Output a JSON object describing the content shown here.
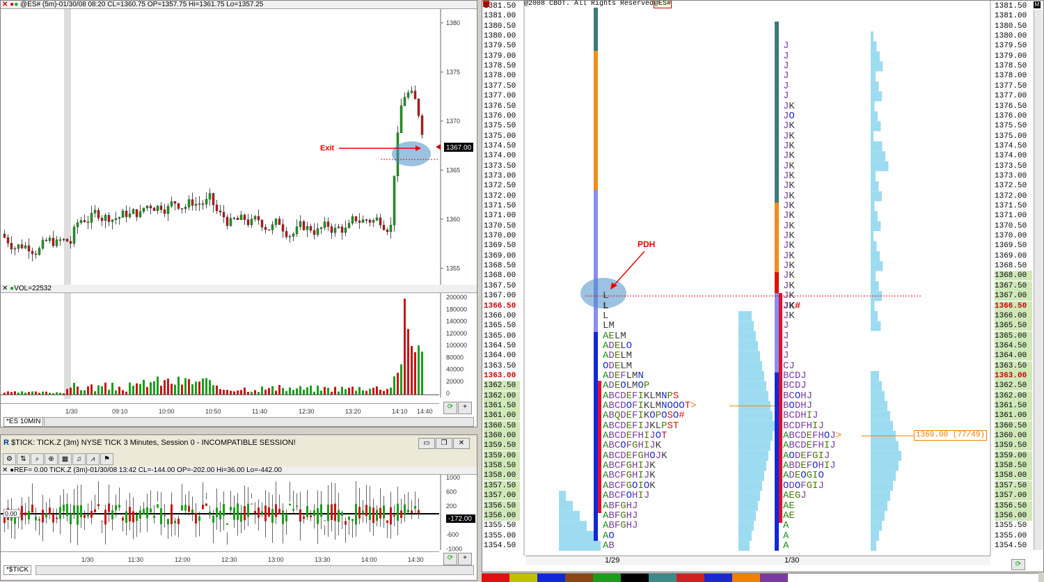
{
  "es_chart": {
    "header": "@ES# (5m)-01/30/08 08:20 CL=1360.75 OP=1357.75 Hi=1361.75 Lo=1357.25",
    "y_ticks": [
      "1380",
      "1375",
      "1370",
      "1365",
      "1360",
      "1355"
    ],
    "last_price": "1367.00",
    "exit_label": "Exit",
    "vol_header": "VOL=22532",
    "vol_ticks": [
      "200000",
      "180000",
      "140000",
      "120000",
      "100000",
      "80000",
      "40000",
      "20000",
      "0"
    ],
    "x_ticks": [
      "1/30",
      "09:10",
      "10:00",
      "10:50",
      "11:40",
      "12:30",
      "13:20",
      "14:10",
      "14:40"
    ],
    "tab": "*ES 10MIN"
  },
  "tick_chart": {
    "title": "$TICK: TICK.Z (3m) NYSE TICK 3 Minutes, Session 0 - INCOMPATIBLE SESSION!",
    "header": "REF= 0.00  TICK.Z (3m)-01/30/08 13:42 CL=-144.00 OP=-202.00 Hi=36.00 Lo=-442.00",
    "y_ticks": [
      "1000",
      "600",
      "200",
      "-200",
      "-600",
      "-1000"
    ],
    "zero_label": "0.00",
    "last_value": "-172.00",
    "x_ticks": [
      "1/30",
      "11:30",
      "12:00",
      "12:30",
      "13:00",
      "13:30",
      "14:00",
      "14:30"
    ],
    "tab": "*$TICK"
  },
  "market_profile": {
    "copyright": "@2008 CBOT. All Rights Reserved",
    "symbol": "@ES#",
    "pdh_label": "PDH",
    "value_label": "1360.00 (77/49)",
    "day1": "1/29",
    "day2": "1/30",
    "prices": [
      "1381.50",
      "1381.00",
      "1380.50",
      "1380.00",
      "1379.50",
      "1379.00",
      "1378.50",
      "1378.00",
      "1377.50",
      "1377.00",
      "1376.50",
      "1376.00",
      "1375.50",
      "1375.00",
      "1374.50",
      "1374.00",
      "1373.50",
      "1373.00",
      "1372.50",
      "1372.00",
      "1371.50",
      "1371.00",
      "1370.50",
      "1370.00",
      "1369.50",
      "1369.00",
      "1368.50",
      "1368.00",
      "1367.50",
      "1367.00",
      "1366.50",
      "1366.00",
      "1365.50",
      "1365.00",
      "1364.50",
      "1364.00",
      "1363.50",
      "1363.00",
      "1362.50",
      "1362.00",
      "1361.50",
      "1361.00",
      "1360.50",
      "1360.00",
      "1359.50",
      "1359.00",
      "1358.50",
      "1358.00",
      "1357.50",
      "1357.00",
      "1356.50",
      "1356.00",
      "1355.50",
      "1355.00",
      "1354.50"
    ],
    "day1_rows": [
      {
        "p": "1367.00",
        "t": "L"
      },
      {
        "p": "1366.50",
        "t": "L"
      },
      {
        "p": "1366.00",
        "t": "L"
      },
      {
        "p": "1365.50",
        "t": "LM"
      },
      {
        "p": "1365.00",
        "t": "AELM"
      },
      {
        "p": "1364.50",
        "t": "ADELO"
      },
      {
        "p": "1364.00",
        "t": "ADELM"
      },
      {
        "p": "1363.50",
        "t": "ODELM"
      },
      {
        "p": "1363.00",
        "t": "ADEFLMN"
      },
      {
        "p": "1362.50",
        "t": "ADEOLMOP"
      },
      {
        "p": "1362.00",
        "t": "ABCDEFIKLMNPS"
      },
      {
        "p": "1361.50",
        "t": "ABCDOFIKLMNOOOT>"
      },
      {
        "p": "1361.00",
        "t": "ABQDEFIKOPOSO#"
      },
      {
        "p": "1360.50",
        "t": "ABCDEFIJKLPST"
      },
      {
        "p": "1360.00",
        "t": "ABCDEFHIJOT"
      },
      {
        "p": "1359.50",
        "t": "ABCOFGHIJK"
      },
      {
        "p": "1359.00",
        "t": "ABCDEFGHOJK"
      },
      {
        "p": "1358.50",
        "t": "ABCFGHIJK"
      },
      {
        "p": "1358.00",
        "t": "ABCFGHIJK"
      },
      {
        "p": "1357.50",
        "t": "ABCFGOIOK"
      },
      {
        "p": "1357.00",
        "t": "ABCFOHIJ"
      },
      {
        "p": "1356.50",
        "t": "ABFGHJ"
      },
      {
        "p": "1356.00",
        "t": "ABFGHJ"
      },
      {
        "p": "1355.50",
        "t": "ABFGHJ"
      },
      {
        "p": "1355.00",
        "t": "AO"
      },
      {
        "p": "1354.50",
        "t": "AB"
      }
    ],
    "day2_rows": [
      {
        "p": "1379.50",
        "t": "J"
      },
      {
        "p": "1379.00",
        "t": "J"
      },
      {
        "p": "1378.50",
        "t": "J"
      },
      {
        "p": "1378.00",
        "t": "J"
      },
      {
        "p": "1377.50",
        "t": "J"
      },
      {
        "p": "1377.00",
        "t": "J"
      },
      {
        "p": "1376.50",
        "t": "JK"
      },
      {
        "p": "1376.00",
        "t": "JO"
      },
      {
        "p": "1375.50",
        "t": "JK"
      },
      {
        "p": "1375.00",
        "t": "JK"
      },
      {
        "p": "1374.50",
        "t": "JK"
      },
      {
        "p": "1374.00",
        "t": "JK"
      },
      {
        "p": "1373.50",
        "t": "JK"
      },
      {
        "p": "1373.00",
        "t": "JK"
      },
      {
        "p": "1372.50",
        "t": "JK"
      },
      {
        "p": "1372.00",
        "t": "JK"
      },
      {
        "p": "1371.50",
        "t": "JK"
      },
      {
        "p": "1371.00",
        "t": "JK"
      },
      {
        "p": "1370.50",
        "t": "JK"
      },
      {
        "p": "1370.00",
        "t": "JK"
      },
      {
        "p": "1369.50",
        "t": "JK"
      },
      {
        "p": "1369.00",
        "t": "JK"
      },
      {
        "p": "1368.50",
        "t": "JK"
      },
      {
        "p": "1368.00",
        "t": "JK"
      },
      {
        "p": "1367.50",
        "t": "JK"
      },
      {
        "p": "1367.00",
        "t": "JK"
      },
      {
        "p": "1366.50",
        "t": "JK#"
      },
      {
        "p": "1366.00",
        "t": "JK"
      },
      {
        "p": "1365.50",
        "t": "J"
      },
      {
        "p": "1365.00",
        "t": "J"
      },
      {
        "p": "1364.50",
        "t": "J"
      },
      {
        "p": "1364.00",
        "t": "J"
      },
      {
        "p": "1363.50",
        "t": "CJ"
      },
      {
        "p": "1363.00",
        "t": "BCDJ"
      },
      {
        "p": "1362.50",
        "t": "BCDJ"
      },
      {
        "p": "1362.00",
        "t": "BCOHJ"
      },
      {
        "p": "1361.50",
        "t": "BODHJ"
      },
      {
        "p": "1361.00",
        "t": "BCDHIJ"
      },
      {
        "p": "1360.50",
        "t": "BCDFHIJ"
      },
      {
        "p": "1360.00",
        "t": "ABCDEFHOJ>"
      },
      {
        "p": "1359.50",
        "t": "ABCDEFHIJ"
      },
      {
        "p": "1359.00",
        "t": "AODEFGIJ"
      },
      {
        "p": "1358.50",
        "t": "ABDEFOHIJ"
      },
      {
        "p": "1358.00",
        "t": "ADEOGIO"
      },
      {
        "p": "1357.50",
        "t": "ODOFGIJ"
      },
      {
        "p": "1357.00",
        "t": "AEGJ"
      },
      {
        "p": "1356.50",
        "t": "AE"
      },
      {
        "p": "1356.00",
        "t": "AE"
      },
      {
        "p": "1355.50",
        "t": "A"
      },
      {
        "p": "1355.00",
        "t": "A"
      },
      {
        "p": "1354.50",
        "t": "A"
      }
    ]
  }
}
